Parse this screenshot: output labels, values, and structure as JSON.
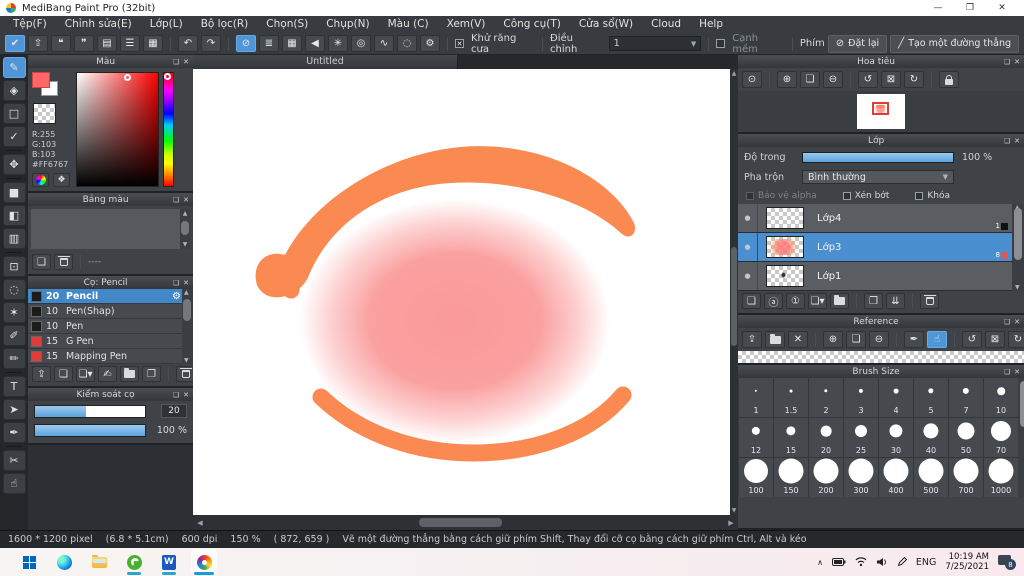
{
  "window": {
    "title": "MediBang Paint Pro (32bit)",
    "controls": {
      "minimize": "—",
      "restore": "❐",
      "close": "✕"
    }
  },
  "menu": [
    "Tệp(F)",
    "Chỉnh sửa(E)",
    "Lớp(L)",
    "Bộ lọc(R)",
    "Chọn(S)",
    "Chụp(N)",
    "Màu (C)",
    "Xem(V)",
    "Công cụ(T)",
    "Cửa sổ(W)",
    "Cloud",
    "Help"
  ],
  "toolbar": {
    "icons": [
      {
        "n": "cloud-save-icon",
        "g": "✔",
        "sel": true
      },
      {
        "n": "share-icon",
        "g": "⇧"
      },
      {
        "n": "comment-icon",
        "g": "❝"
      },
      {
        "n": "chat-icon",
        "g": "❞"
      },
      {
        "n": "document-icon",
        "g": "▤"
      },
      {
        "n": "material-icon",
        "g": "☰"
      },
      {
        "n": "canvas-split-icon",
        "g": "▦"
      },
      {
        "div": true
      },
      {
        "n": "undo-icon",
        "g": "↶"
      },
      {
        "n": "redo-icon",
        "g": "↷"
      },
      {
        "div": true
      },
      {
        "n": "snap-off-icon",
        "g": "⊘",
        "sel": true
      },
      {
        "n": "snap-parallel-icon",
        "g": "≣"
      },
      {
        "n": "snap-grid-icon",
        "g": "▦"
      },
      {
        "n": "snap-vanishing-icon",
        "g": "◀"
      },
      {
        "n": "snap-radial-icon",
        "g": "✳"
      },
      {
        "n": "snap-concentric-icon",
        "g": "◎"
      },
      {
        "n": "snap-curve-icon",
        "g": "∿"
      },
      {
        "n": "snap-ellipse-icon",
        "g": "◌"
      },
      {
        "n": "snap-settings-icon",
        "g": "⚙"
      }
    ],
    "antialias_label": "Khử răng cưa",
    "antialias_mark": "✕",
    "correction_label": "Điều chỉnh",
    "correction_value": "1",
    "soft_edge_label": "Cạnh mềm",
    "key_label": "Phím",
    "reset_button": "Đặt lại",
    "reset_icon": "⊘",
    "line_button": "Tạo một đường thẳng",
    "line_icon": "╱"
  },
  "tools": [
    {
      "n": "brush-tool",
      "g": "✎",
      "sel": true
    },
    {
      "n": "eraser-tool",
      "g": "◈"
    },
    {
      "n": "dot-tool",
      "g": "□"
    },
    {
      "n": "polyline-tool",
      "g": "✓"
    },
    {
      "div": true
    },
    {
      "n": "move-tool",
      "g": "✥"
    },
    {
      "div": true
    },
    {
      "n": "fill-shape-tool",
      "g": "■"
    },
    {
      "n": "bucket-tool",
      "g": "◧"
    },
    {
      "n": "gradient-tool",
      "g": "▥"
    },
    {
      "div": true
    },
    {
      "n": "select-tool",
      "g": "⊡"
    },
    {
      "n": "lasso-tool",
      "g": "◌"
    },
    {
      "n": "magic-wand-tool",
      "g": "✶"
    },
    {
      "n": "select-pen-tool",
      "g": "✐"
    },
    {
      "n": "select-eraser-tool",
      "g": "✏"
    },
    {
      "div": true
    },
    {
      "n": "text-tool",
      "g": "T"
    },
    {
      "n": "operation-tool",
      "g": "➤"
    },
    {
      "n": "eyedropper-tool",
      "g": "✒"
    },
    {
      "div": true
    },
    {
      "n": "divide-tool",
      "g": "✂"
    },
    {
      "n": "hand-tool",
      "g": "☝"
    }
  ],
  "panels": {
    "color": {
      "title": "Màu",
      "r": "R:255",
      "g": "G:103",
      "b": "B:103",
      "hex": "#FF6767",
      "foreground": "#ff6767",
      "background": "#ffffff",
      "buttons": [
        {
          "n": "color-wheel-icon",
          "c": "css-wheel"
        },
        {
          "n": "color-set-icon",
          "g": "❖"
        }
      ]
    },
    "palette": {
      "title": "Bảng màu",
      "empty_label": "----",
      "buttons": [
        {
          "n": "new-palette-icon",
          "g": "❏"
        },
        {
          "n": "delete-palette-icon",
          "c": "css-trash"
        }
      ]
    },
    "brush_list": {
      "title": "Cọ: Pencil",
      "items": [
        {
          "size": "20",
          "name": "Pencil",
          "swatch": "#1b1b1b",
          "sel": true
        },
        {
          "size": "10",
          "name": "Pen(Shap)",
          "swatch": "#1b1b1b"
        },
        {
          "size": "10",
          "name": "Pen",
          "swatch": "#1b1b1b"
        },
        {
          "size": "15",
          "name": "G Pen",
          "swatch": "#e03c3c"
        },
        {
          "size": "15",
          "name": "Mapping Pen",
          "swatch": "#e03c3c"
        }
      ],
      "gear": "⚙",
      "buttons": [
        {
          "n": "brush-cloud-icon",
          "g": "⇪"
        },
        {
          "n": "new-brush-icon",
          "g": "❏"
        },
        {
          "n": "add-brush-menu-icon",
          "g": "❏▾"
        },
        {
          "n": "brush-script-icon",
          "g": "✍"
        },
        {
          "n": "brush-folder-icon",
          "c": "css-folder"
        },
        {
          "n": "duplicate-brush-icon",
          "g": "❐"
        },
        {
          "div": true
        },
        {
          "n": "delete-brush-icon",
          "c": "css-trash"
        }
      ]
    },
    "brush_control": {
      "title": "Kiểm soát cọ",
      "size_fill": "46%",
      "size_value": "20",
      "opacity_fill": "100%",
      "opacity_value": "100 %"
    },
    "navigator": {
      "title": "Hoa tiêu",
      "icons": [
        {
          "n": "zoom-actual-icon",
          "g": "⊙"
        },
        {
          "div": true
        },
        {
          "n": "zoom-in-icon",
          "g": "⊕"
        },
        {
          "n": "zoom-fit-icon",
          "g": "❏"
        },
        {
          "n": "zoom-out-icon",
          "g": "⊖"
        },
        {
          "div": true
        },
        {
          "n": "rotate-left-icon",
          "g": "↺"
        },
        {
          "n": "rotate-reset-icon",
          "g": "⊠"
        },
        {
          "n": "rotate-right-icon",
          "g": "↻"
        },
        {
          "div": true
        },
        {
          "n": "rotate-lock-icon",
          "c": "css-lock"
        }
      ]
    },
    "layers": {
      "title": "Lớp",
      "opacity_label": "Độ trong",
      "opacity_value": "100 %",
      "blend_label": "Pha trộn",
      "blend_value": "Bình thường",
      "checks": [
        {
          "label": "Bảo vệ alpha",
          "disabled": true
        },
        {
          "label": "Xén bớt"
        },
        {
          "label": "Khóa"
        }
      ],
      "items": [
        {
          "name": "Lớp4",
          "badge": "1",
          "badge_color": "#111111"
        },
        {
          "name": "Lớp3",
          "badge": "8",
          "badge_color": "#e05555",
          "sel": true,
          "gear": "⚙",
          "thumb": "pink"
        },
        {
          "name": "Lớp1",
          "thumb": "dot"
        }
      ],
      "buttons": [
        {
          "n": "add-layer-icon",
          "g": "❏"
        },
        {
          "n": "add-8bit-layer-icon",
          "g": "ⓐ"
        },
        {
          "n": "add-1bit-layer-icon",
          "g": "①"
        },
        {
          "n": "add-material-layer-icon",
          "g": "❏▾"
        },
        {
          "n": "layer-folder-icon",
          "c": "css-folder"
        },
        {
          "div": true
        },
        {
          "n": "duplicate-layer-icon",
          "g": "❐"
        },
        {
          "n": "merge-layer-icon",
          "g": "⇊"
        },
        {
          "div": true
        },
        {
          "n": "delete-layer-icon",
          "c": "css-trash"
        }
      ]
    },
    "reference": {
      "title": "Reference",
      "icons": [
        {
          "n": "ref-cloud-icon",
          "g": "⇪"
        },
        {
          "n": "ref-folder-icon",
          "c": "css-folder"
        },
        {
          "n": "ref-close-icon",
          "g": "✕"
        },
        {
          "div": true
        },
        {
          "n": "ref-zoom-in-icon",
          "g": "⊕"
        },
        {
          "n": "ref-fit-icon",
          "g": "❏"
        },
        {
          "n": "ref-zoom-out-icon",
          "g": "⊖"
        },
        {
          "div": true
        },
        {
          "n": "ref-eyedropper-icon",
          "g": "✒"
        },
        {
          "n": "ref-hand-icon",
          "g": "☝",
          "sel": true
        },
        {
          "div": true
        },
        {
          "n": "ref-rotate-left-icon",
          "g": "↺"
        },
        {
          "n": "ref-rotate-reset-icon",
          "g": "⊠"
        },
        {
          "n": "ref-rotate-right-icon",
          "g": "↻"
        },
        {
          "div": true
        },
        {
          "n": "ref-lock-icon",
          "c": "css-lock"
        }
      ]
    },
    "brush_size": {
      "title": "Brush Size",
      "sizes": [
        "1",
        "1.5",
        "2",
        "3",
        "4",
        "5",
        "7",
        "10",
        "12",
        "15",
        "20",
        "25",
        "30",
        "40",
        "50",
        "70",
        "100",
        "150",
        "200",
        "300",
        "400",
        "500",
        "700",
        "1000"
      ]
    }
  },
  "canvas": {
    "tab": "Untitled"
  },
  "art": {
    "orange": "#fb8a52",
    "pink": "#f98484"
  },
  "status": {
    "parts": [
      "1600 * 1200 pixel",
      "(6.8 * 5.1cm)",
      "600 dpi",
      "150 %",
      "( 872, 659 )",
      "Vẽ một đường thẳng bằng cách giữ phím Shift, Thay đổi cỡ cọ bằng cách giữ phím Ctrl, Alt và kéo"
    ]
  },
  "taskbar": {
    "word_label": "W",
    "tray": {
      "chevron": "∧",
      "lang": "ENG",
      "time": "10:19 AM",
      "date": "7/25/2021",
      "badge": "8"
    }
  }
}
